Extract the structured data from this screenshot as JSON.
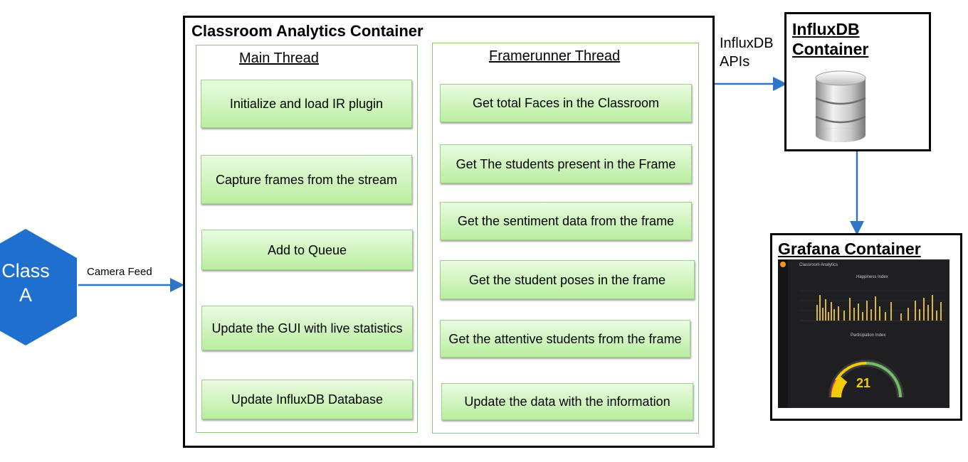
{
  "class_node": {
    "label_line1": "Class",
    "label_line2": "A",
    "color": "#1f6fcf"
  },
  "camera_feed_label": "Camera Feed",
  "analytics_container": {
    "title": "Classroom Analytics Container",
    "main_thread": {
      "title": "Main Thread",
      "steps": [
        "Initialize and load IR plugin",
        "Capture frames from the stream",
        "Add to Queue",
        "Update the GUI with live statistics",
        "Update InfluxDB Database"
      ]
    },
    "framerunner_thread": {
      "title": "Framerunner Thread",
      "steps": [
        "Get total Faces in the Classroom",
        "Get The students present in the Frame",
        "Get the sentiment data from the frame",
        "Get the student poses in the frame",
        "Get the attentive students from the frame",
        "Update the data with the information"
      ]
    }
  },
  "influx_apis_label": {
    "line1": "InfluxDB",
    "line2": "APIs"
  },
  "influx_container": {
    "title_line1": "InfluxDB",
    "title_line2": "Container",
    "icon": "database-icon"
  },
  "grafana_container": {
    "title": "Grafana Container",
    "dashboard": {
      "name": "Classroom Analytics",
      "panel1_title": "Happiness Index",
      "panel2_title": "Participation Index",
      "gauge_value": "21",
      "gauge_color": "#f2cc0c"
    }
  },
  "colors": {
    "arrow": "#2e75c5",
    "flow_arrow": "#8cc47a",
    "step_fill": "#b9ee9e"
  }
}
